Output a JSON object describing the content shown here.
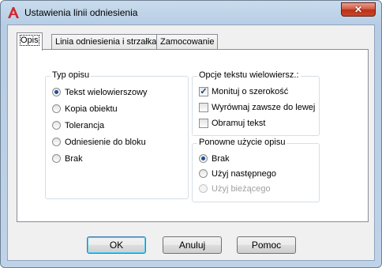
{
  "window": {
    "title": "Ustawienia linii odniesienia",
    "close_glyph": "✕",
    "icon": "autocad-a-icon",
    "accent": "#c8462b"
  },
  "tabs": [
    {
      "label": "Opis",
      "active": true
    },
    {
      "label": "Linia odniesienia i strzałka",
      "active": false
    },
    {
      "label": "Zamocowanie",
      "active": false
    }
  ],
  "typ_opisu": {
    "legend": "Typ opisu",
    "options": [
      {
        "label": "Tekst wielowierszowy",
        "checked": true
      },
      {
        "label": "Kopia obiektu",
        "checked": false
      },
      {
        "label": "Tolerancja",
        "checked": false
      },
      {
        "label": "Odniesienie do bloku",
        "checked": false
      },
      {
        "label": "Brak",
        "checked": false
      }
    ]
  },
  "opcje_tekstu": {
    "legend": "Opcje tekstu wielowiersz.:",
    "options": [
      {
        "label": "Monituj o szerokość",
        "checked": true
      },
      {
        "label": "Wyrównaj zawsze do lewej",
        "checked": false
      },
      {
        "label": "Obramuj tekst",
        "checked": false
      }
    ]
  },
  "ponowne_uzycie": {
    "legend": "Ponowne użycie opisu",
    "options": [
      {
        "label": "Brak",
        "checked": true,
        "enabled": true
      },
      {
        "label": "Użyj następnego",
        "checked": false,
        "enabled": true
      },
      {
        "label": "Użyj bieżącego",
        "checked": false,
        "enabled": false
      }
    ]
  },
  "buttons": {
    "ok": "OK",
    "cancel": "Anuluj",
    "help": "Pomoc"
  }
}
